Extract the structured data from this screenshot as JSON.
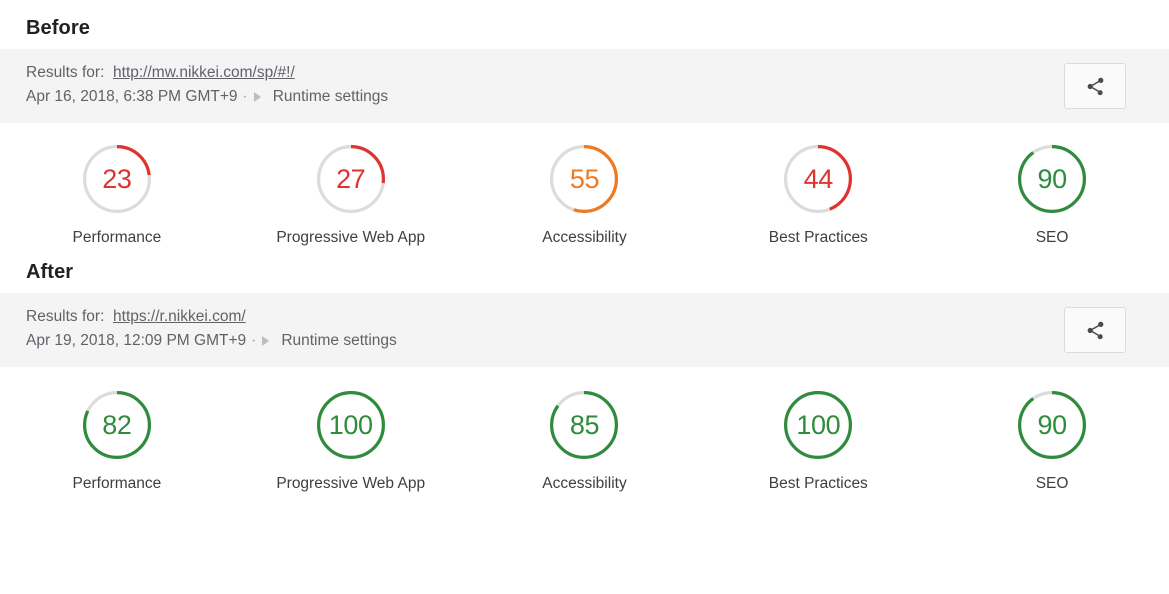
{
  "colors": {
    "red": "#df332f",
    "orange": "#ef7a21",
    "green": "#2f8c3c",
    "track": "#dcdcdc",
    "band_bg": "#f4f4f4",
    "text": "#5f6368"
  },
  "sections": [
    {
      "heading": "Before",
      "results_label": "Results for:",
      "url": "http://mw.nikkei.com/sp/#!/",
      "timestamp": "Apr 16, 2018, 6:38 PM GMT+9",
      "separator": "·",
      "runtime_settings_label": "Runtime settings",
      "share_icon": "share-icon",
      "gauges": [
        {
          "score": "23",
          "value": 23,
          "label": "Performance",
          "color": "red"
        },
        {
          "score": "27",
          "value": 27,
          "label": "Progressive Web App",
          "color": "red"
        },
        {
          "score": "55",
          "value": 55,
          "label": "Accessibility",
          "color": "orange"
        },
        {
          "score": "44",
          "value": 44,
          "label": "Best Practices",
          "color": "red"
        },
        {
          "score": "90",
          "value": 90,
          "label": "SEO",
          "color": "green"
        }
      ]
    },
    {
      "heading": "After",
      "results_label": "Results for:",
      "url": "https://r.nikkei.com/",
      "timestamp": "Apr 19, 2018, 12:09 PM GMT+9",
      "separator": "·",
      "runtime_settings_label": "Runtime settings",
      "share_icon": "share-icon",
      "gauges": [
        {
          "score": "82",
          "value": 82,
          "label": "Performance",
          "color": "green"
        },
        {
          "score": "100",
          "value": 100,
          "label": "Progressive Web App",
          "color": "green"
        },
        {
          "score": "85",
          "value": 85,
          "label": "Accessibility",
          "color": "green"
        },
        {
          "score": "100",
          "value": 100,
          "label": "Best Practices",
          "color": "green"
        },
        {
          "score": "90",
          "value": 90,
          "label": "SEO",
          "color": "green"
        }
      ]
    }
  ]
}
